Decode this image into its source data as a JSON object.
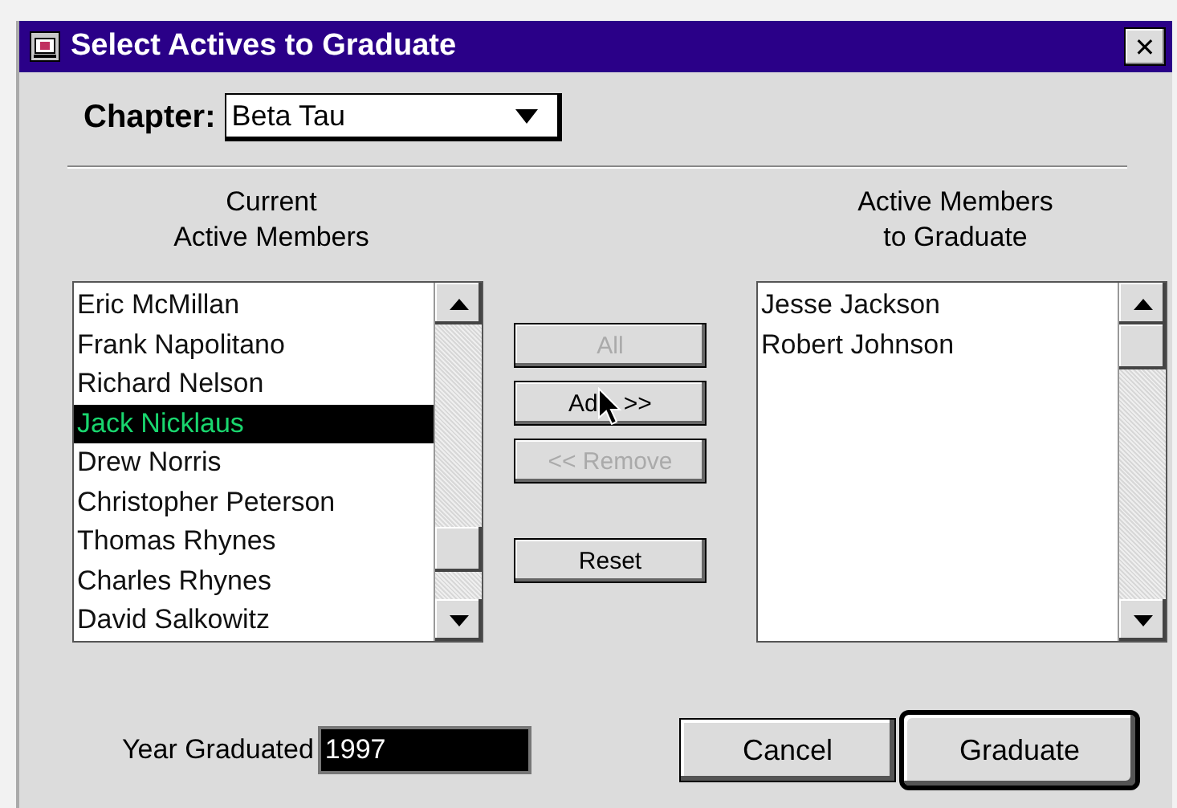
{
  "window": {
    "title": "Select Actives to Graduate",
    "close": "✕"
  },
  "chapter": {
    "label": "Chapter:",
    "value": "Beta Tau"
  },
  "current_members": {
    "heading": [
      "Current",
      "Active Members"
    ],
    "items": [
      {
        "name": "Eric McMillan",
        "selected": false
      },
      {
        "name": "Frank Napolitano",
        "selected": false
      },
      {
        "name": "Richard Nelson",
        "selected": false
      },
      {
        "name": "Jack Nicklaus",
        "selected": true
      },
      {
        "name": "Drew Norris",
        "selected": false
      },
      {
        "name": "Christopher Peterson",
        "selected": false
      },
      {
        "name": "Thomas Rhynes",
        "selected": false
      },
      {
        "name": "Charles Rhynes",
        "selected": false
      },
      {
        "name": "David Salkowitz",
        "selected": false
      }
    ]
  },
  "actions": [
    {
      "label_parts": [
        "All"
      ],
      "disabled": true
    },
    {
      "label_parts": [
        "Ad",
        ">>"
      ],
      "disabled": false,
      "cursor": true
    },
    {
      "label_parts": [
        "<< Remove"
      ],
      "disabled": true
    },
    {
      "label_parts": [
        "Reset"
      ],
      "disabled": false
    }
  ],
  "graduating_members": {
    "heading": [
      "Active Members",
      "to Graduate"
    ],
    "items": [
      {
        "name": "Jesse Jackson",
        "selected": false
      },
      {
        "name": "Robert Johnson",
        "selected": false
      }
    ]
  },
  "year": {
    "label": "Year Graduated",
    "value": "1997"
  },
  "buttons": [
    {
      "label": "Cancel",
      "default": false
    },
    {
      "label": "Graduate",
      "default": true
    }
  ]
}
